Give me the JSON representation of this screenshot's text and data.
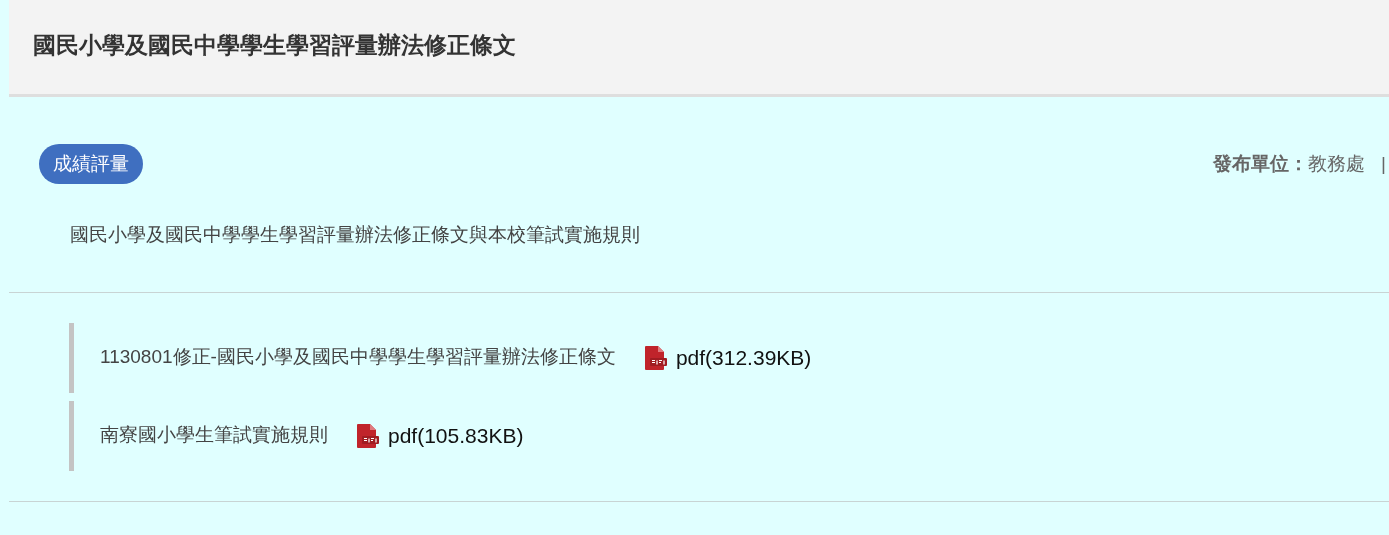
{
  "title": "國民小學及國民中學學生學習評量辦法修正條文",
  "category": "成績評量",
  "publisher": {
    "label": "發布單位：",
    "value": "教務處",
    "separator": "|"
  },
  "description": "國民小學及國民中學學生學習評量辦法修正條文與本校筆試實施規則",
  "attachments": [
    {
      "name": "1130801修正-國民小學及國民中學學生學習評量辦法修正條文",
      "file": "pdf(312.39KB)"
    },
    {
      "name": "南寮國小學生筆試實施規則",
      "file": "pdf(105.83KB)"
    }
  ]
}
